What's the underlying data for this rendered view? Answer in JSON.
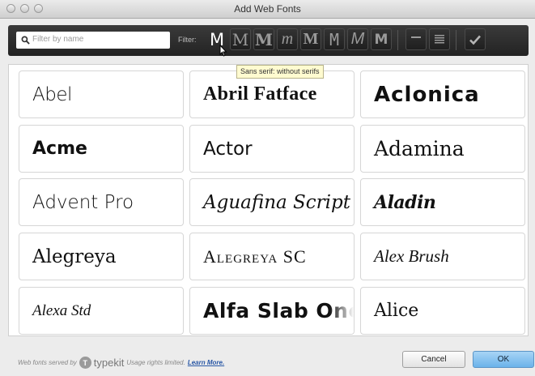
{
  "window": {
    "title": "Add Web Fonts"
  },
  "toolbar": {
    "search_placeholder": "Filter by name",
    "filter_label": "Filter:",
    "filters": [
      {
        "glyph": "M",
        "name": "filter-sans-serif-button"
      },
      {
        "glyph": "M",
        "name": "filter-serif-button"
      },
      {
        "glyph": "M",
        "name": "filter-slab-serif-button"
      },
      {
        "glyph": "m",
        "name": "filter-script-button"
      },
      {
        "glyph": "M",
        "name": "filter-blackletter-button"
      },
      {
        "glyph": "M",
        "name": "filter-monospace-button"
      },
      {
        "glyph": "M",
        "name": "filter-handmade-button"
      },
      {
        "glyph": "M",
        "name": "filter-decorative-button"
      }
    ]
  },
  "tooltip": "Sans serif: without serifs",
  "fonts": [
    "Abel",
    "Abril Fatface",
    "Aclonica",
    "Acme",
    "Actor",
    "Adamina",
    "Advent Pro",
    "Aguafina Script",
    "Aladin",
    "Alegreya",
    "Alegreya SC",
    "Alex Brush",
    "Alexa Std",
    "Alfa Slab One",
    "Alice"
  ],
  "footer": {
    "credit_prefix": "Web fonts served by",
    "brand": "typekit",
    "usage": "Usage rights limited.",
    "learn_more": "Learn More.",
    "cancel_label": "Cancel",
    "ok_label": "OK"
  },
  "colors": {
    "toolbar_bg": "#2c2c2c",
    "ok_button": "#7dbdf0",
    "link": "#2a58a6"
  }
}
